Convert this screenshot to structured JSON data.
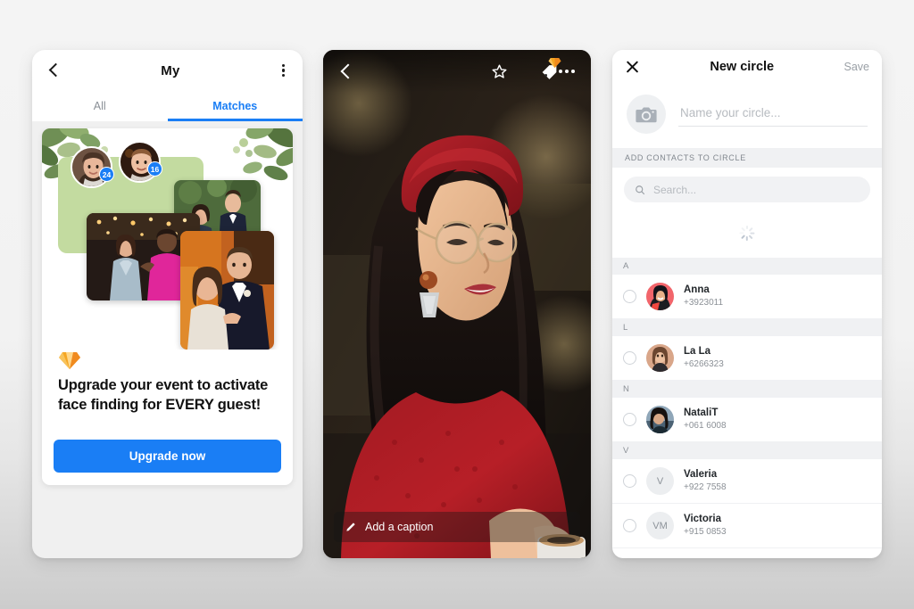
{
  "panel1": {
    "header": {
      "title": "My",
      "back_icon": "chevron-left-icon",
      "menu_icon": "kebab-menu-icon"
    },
    "tabs": [
      {
        "label": "All",
        "active": false
      },
      {
        "label": "Matches",
        "active": true
      }
    ],
    "promo": {
      "gem_icon": "diamond-icon",
      "headline": "Upgrade your event to activate face finding for EVERY guest!",
      "cta_label": "Upgrade now",
      "cta_color": "#1a7ef5",
      "faces": [
        {
          "badge": "24"
        },
        {
          "badge": "16"
        }
      ]
    }
  },
  "panel2": {
    "toolbar": {
      "back_icon": "chevron-left-icon",
      "star_icon": "star-outline-icon",
      "tag_icon": "tag-icon",
      "tag_badge_icon": "diamond-icon",
      "menu_icon": "ellipsis-icon"
    },
    "caption": {
      "icon": "pencil-icon",
      "label": "Add a caption"
    }
  },
  "panel3": {
    "header": {
      "close_icon": "close-icon",
      "title": "New circle",
      "save_label": "Save"
    },
    "name_field": {
      "placeholder": "Name your circle...",
      "value": "",
      "avatar_icon": "camera-icon"
    },
    "section_label": "ADD CONTACTS TO CIRCLE",
    "search": {
      "placeholder": "Search...",
      "value": "",
      "icon": "search-icon"
    },
    "loading": true,
    "contacts": [
      {
        "section": "A",
        "name": "Anna",
        "phone": "+3923011",
        "initials": "",
        "avatar_color": "#f2656b",
        "has_photo": true
      },
      {
        "section": "L",
        "name": "La  La",
        "phone": "+6266323",
        "initials": "",
        "avatar_color": "#d9a689",
        "has_photo": true
      },
      {
        "section": "N",
        "name": "NataliT",
        "phone": "+061 6008",
        "initials": "",
        "avatar_color": "#44566b",
        "has_photo": true
      },
      {
        "section": "V",
        "name": "Valeria",
        "phone": "+922 7558",
        "initials": "V",
        "avatar_color": "#eceef0",
        "has_photo": false
      },
      {
        "section": "",
        "name": "Victoria",
        "phone": "+915 0853",
        "initials": "VM",
        "avatar_color": "#eceef0",
        "has_photo": false
      }
    ]
  }
}
